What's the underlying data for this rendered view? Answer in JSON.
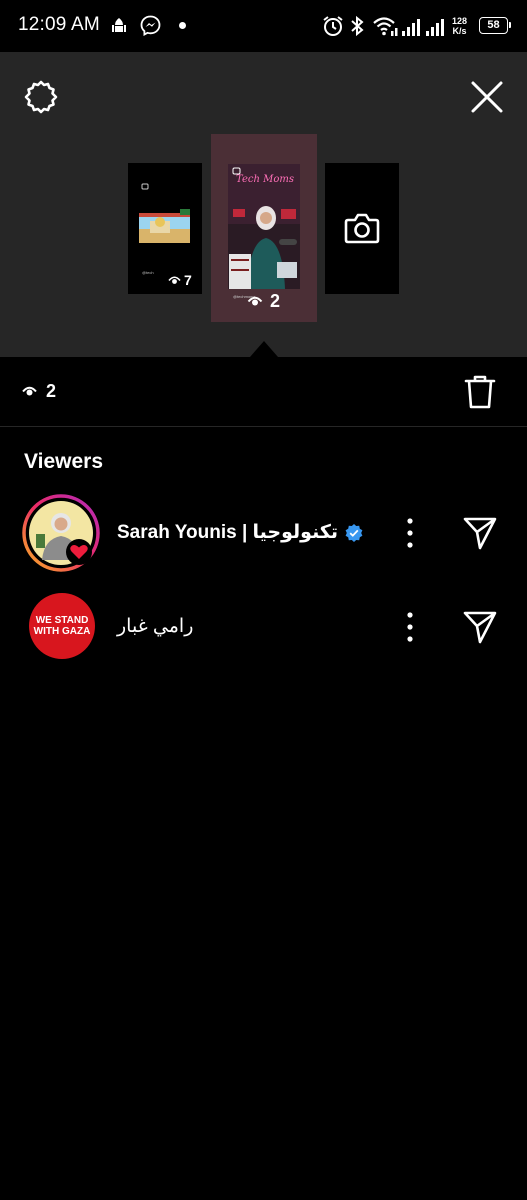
{
  "status_bar": {
    "time": "12:09 AM",
    "network_speed_value": "128",
    "network_speed_unit": "K/s",
    "battery": "58",
    "icons": [
      "mosque-icon",
      "messenger-icon",
      "alarm-icon",
      "bluetooth-icon",
      "wifi-icon",
      "signal-icon"
    ]
  },
  "story_panel": {
    "thumbnails": [
      {
        "kind": "story",
        "views": "7"
      },
      {
        "kind": "story",
        "views": "2",
        "selected": true,
        "neon_text": "Tech Moms"
      },
      {
        "kind": "add-story",
        "icon": "camera-icon"
      }
    ]
  },
  "views_row": {
    "count": "2"
  },
  "viewers": {
    "title": "Viewers",
    "items": [
      {
        "name": "Sarah Younis | تكنولوجيا",
        "verified": true,
        "reacted": true
      },
      {
        "name": "رامي غبار",
        "verified": false,
        "avatar_text_1": "WE STAND",
        "avatar_text_2": "WITH GAZA"
      }
    ]
  },
  "colors": {
    "panel_bg": "#262626",
    "background": "#000000",
    "verified_blue": "#3897f0",
    "heart_red": "#ed1c3c",
    "avatar_red": "#d8161e"
  }
}
